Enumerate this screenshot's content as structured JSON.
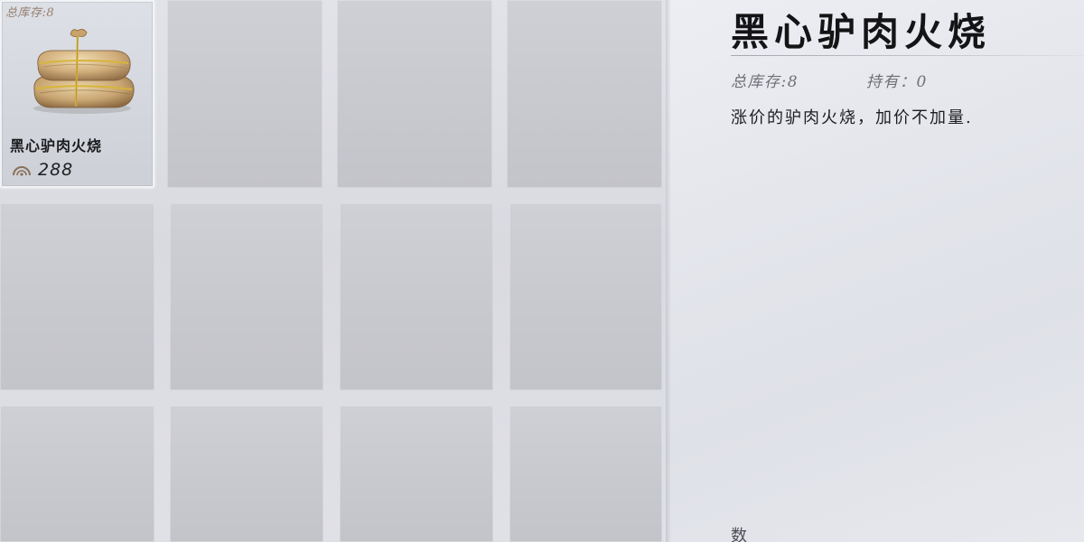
{
  "colors": {
    "background": "#dcdde3",
    "slot": "#c8c9cf",
    "slot_selected_border": "#f2f3f6",
    "title_text": "#141416",
    "stat_text": "#6f7076",
    "stock_overlay": "#8a6f5a"
  },
  "grid": {
    "slots": [
      {
        "selected": true,
        "stock_overlay": "总库存:8",
        "image_icon": "wrapped-food-bundle-icon",
        "name": "黑心驴肉火烧",
        "currency_icon": "coin-icon",
        "price": "288"
      },
      {},
      {},
      {},
      {},
      {},
      {},
      {},
      {},
      {},
      {},
      {}
    ]
  },
  "detail": {
    "title": "黑心驴肉火烧",
    "total_stock": "总库存:8",
    "held": "持有：0",
    "description": "涨价的驴肉火烧，加价不加量.",
    "footer_partial": "数"
  }
}
